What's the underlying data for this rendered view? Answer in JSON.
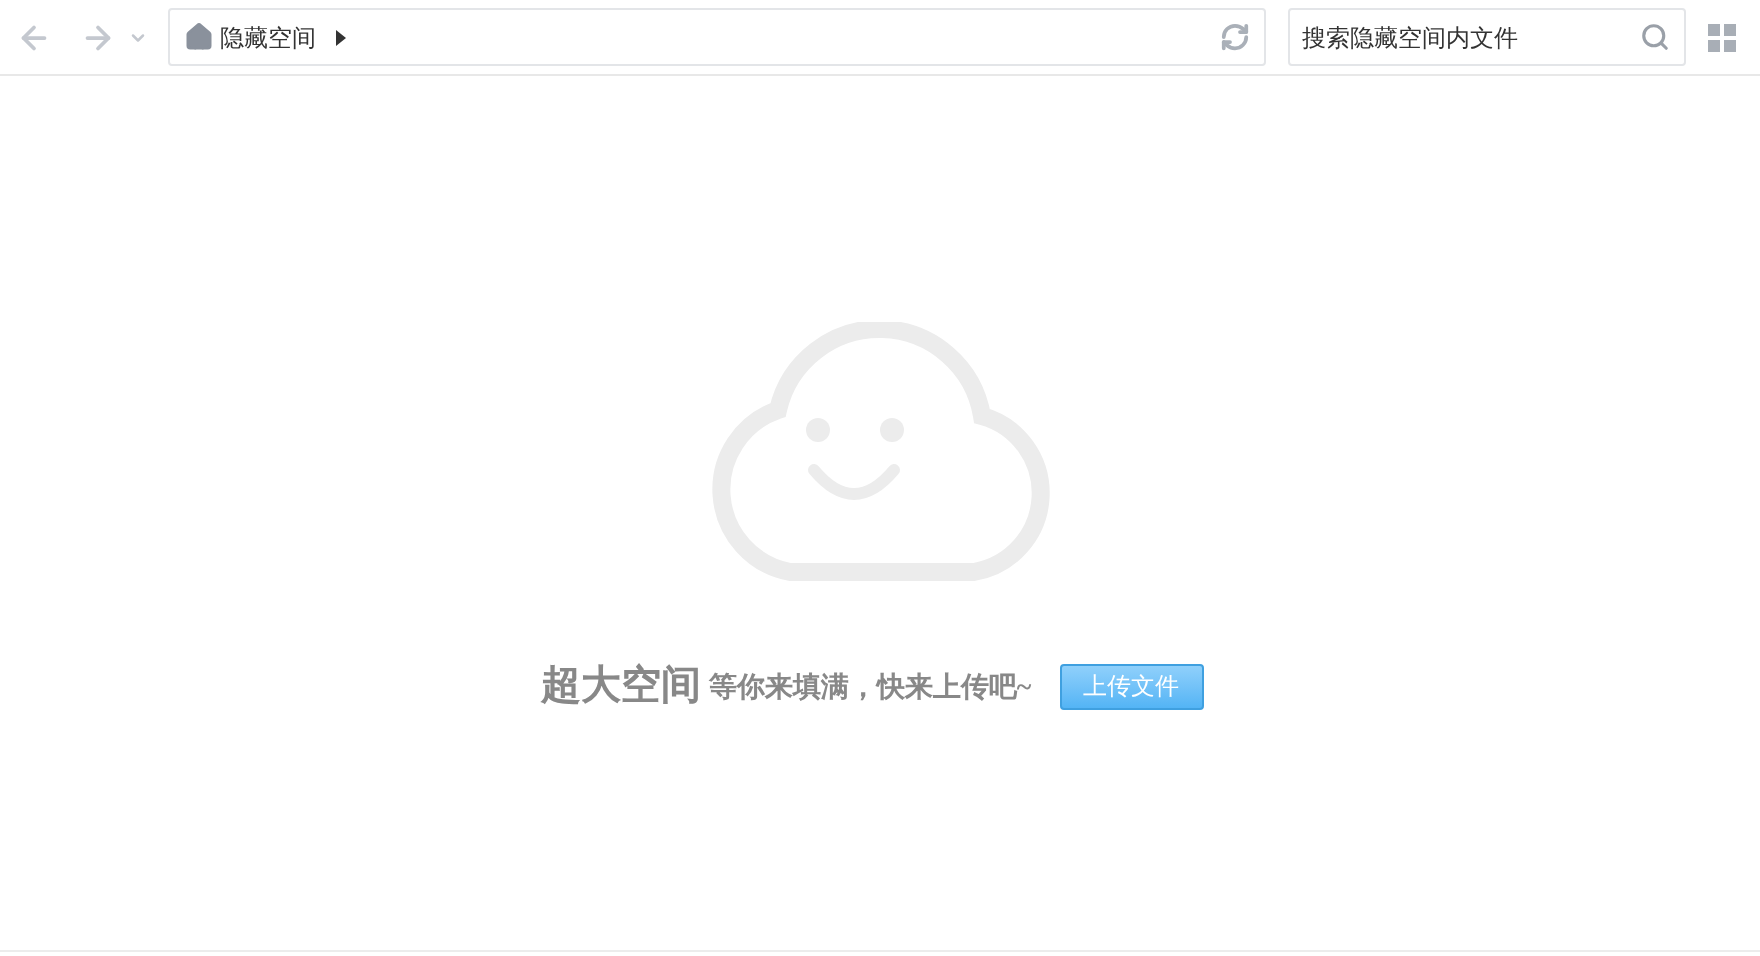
{
  "toolbar": {
    "breadcrumb": "隐藏空间",
    "search": {
      "placeholder": "搜索隐藏空间内文件"
    }
  },
  "empty_state": {
    "headline": "超大空间",
    "message": "等你来填满，快来上传吧~",
    "upload_button": "上传文件"
  }
}
